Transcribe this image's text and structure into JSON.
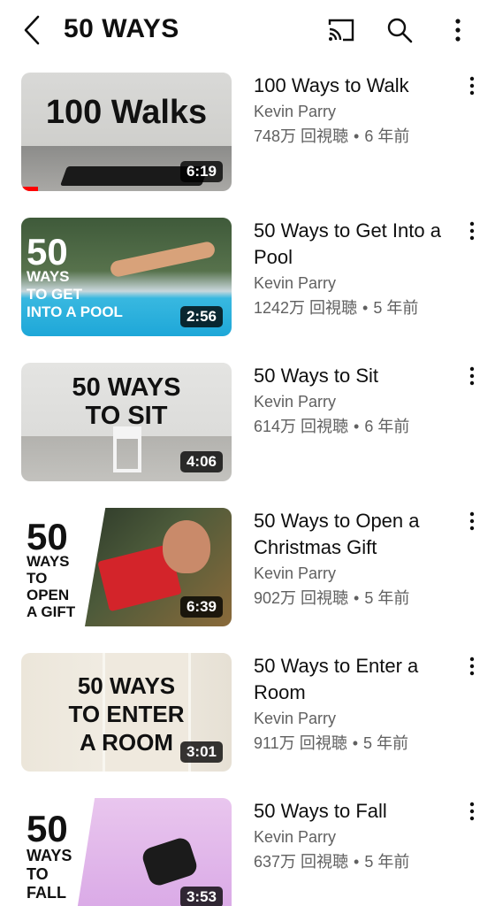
{
  "header": {
    "title": "50 WAYS",
    "icons": [
      "back-icon",
      "cast-icon",
      "search-icon",
      "more-vertical-icon"
    ]
  },
  "videos": [
    {
      "title": "100 Ways to Walk",
      "channel": "Kevin Parry",
      "views": "748万 回視聴",
      "age": "6 年前",
      "duration": "6:19",
      "thumb_text": "100 Walks",
      "watched_fraction": 0.08
    },
    {
      "title": "50 Ways to Get Into a Pool",
      "channel": "Kevin Parry",
      "views": "1242万 回視聴",
      "age": "5 年前",
      "duration": "2:56",
      "thumb_text": [
        "50",
        "WAYS",
        "TO GET",
        "INTO A POOL"
      ]
    },
    {
      "title": "50 Ways to Sit",
      "channel": "Kevin Parry",
      "views": "614万 回視聴",
      "age": "6 年前",
      "duration": "4:06",
      "thumb_text": [
        "50 WAYS",
        "TO SIT"
      ]
    },
    {
      "title": "50 Ways to Open a Christmas Gift",
      "channel": "Kevin Parry",
      "views": "902万 回視聴",
      "age": "5 年前",
      "duration": "6:39",
      "thumb_text": [
        "50",
        "WAYS",
        "TO",
        "OPEN",
        "A GIFT"
      ]
    },
    {
      "title": "50 Ways to Enter a Room",
      "channel": "Kevin Parry",
      "views": "911万 回視聴",
      "age": "5 年前",
      "duration": "3:01",
      "thumb_text": [
        "50 WAYS",
        "TO ENTER",
        "A ROOM"
      ]
    },
    {
      "title": "50 Ways to Fall",
      "channel": "Kevin Parry",
      "views": "637万 回視聴",
      "age": "5 年前",
      "duration": "3:53",
      "thumb_text": [
        "50",
        "WAYS",
        "TO",
        "FALL"
      ]
    }
  ],
  "colors": {
    "text": "#0f0f0f",
    "secondary": "#606060",
    "progress": "#ff0000"
  }
}
